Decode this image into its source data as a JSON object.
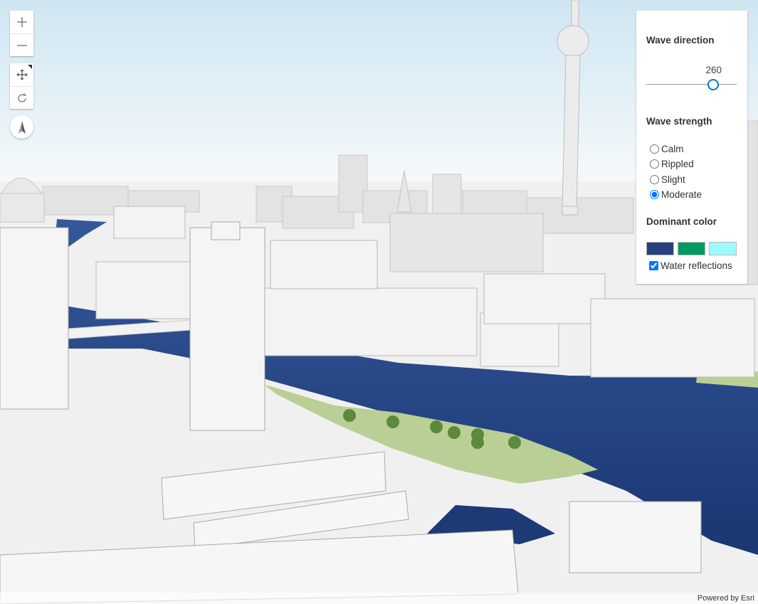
{
  "controls": {
    "zoom_in": "zoom-in",
    "zoom_out": "zoom-out",
    "pan": "pan",
    "rotate": "rotate",
    "compass": "compass"
  },
  "panel": {
    "wave_direction_title": "Wave direction",
    "wave_direction_value": "260",
    "wave_strength_title": "Wave strength",
    "wave_strength_options": [
      "Calm",
      "Rippled",
      "Slight",
      "Moderate"
    ],
    "wave_strength_selected": "Moderate",
    "dominant_color_title": "Dominant color",
    "dominant_colors": [
      "#25417f",
      "#039962",
      "#a0f9ff"
    ],
    "water_reflections_label": "Water reflections",
    "water_reflections_checked": true
  },
  "attribution": "Powered by Esri",
  "colors": {
    "water": "#1f3e7d",
    "park": "#b9cf96",
    "building": "#efefef",
    "sky": "#d6eaf4"
  }
}
